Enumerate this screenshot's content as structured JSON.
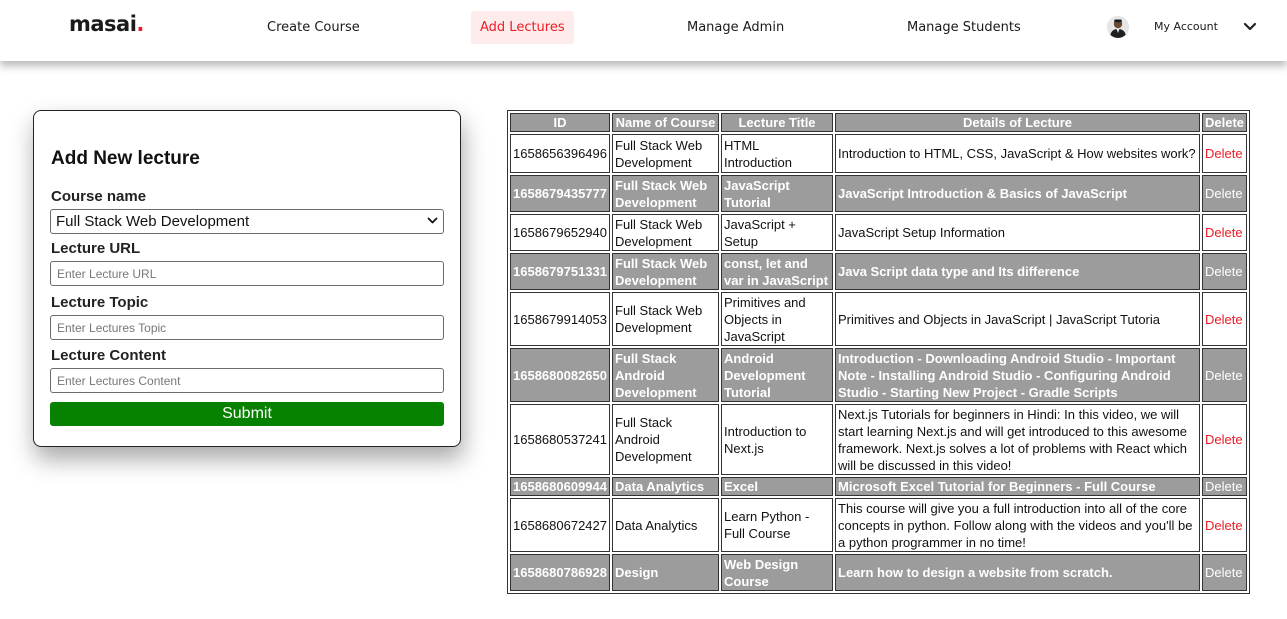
{
  "navbar": {
    "logo": "masai",
    "logo_dot": ".",
    "links": [
      "Create Course",
      "Add Lectures",
      "Manage Admin",
      "Manage Students"
    ],
    "account_label": "My Account"
  },
  "form": {
    "title": "Add New lecture",
    "course_label": "Course name",
    "course_value": "Full Stack Web Development",
    "url_label": "Lecture URL",
    "url_placeholder": "Enter Lecture URL",
    "topic_label": "Lecture Topic",
    "topic_placeholder": "Enter Lectures Topic",
    "content_label": "Lecture Content",
    "content_placeholder": "Enter Lectures Content",
    "submit_label": "Submit"
  },
  "table": {
    "headers": [
      "ID",
      "Name of Course",
      "Lecture Title",
      "Details of Lecture",
      "Delete"
    ],
    "rows": [
      {
        "id": "1658656396496",
        "course": "Full Stack Web Development",
        "title": "HTML Introduction",
        "details": "Introduction to HTML, CSS, JavaScript & How websites work?",
        "action": "Delete"
      },
      {
        "id": "1658679435777",
        "course": "Full Stack Web Development",
        "title": "JavaScript Tutorial",
        "details": "JavaScript Introduction & Basics of JavaScript",
        "action": "Delete"
      },
      {
        "id": "1658679652940",
        "course": "Full Stack Web Development",
        "title": "JavaScript + Setup",
        "details": "JavaScript Setup Information",
        "action": "Delete"
      },
      {
        "id": "1658679751331",
        "course": "Full Stack Web Development",
        "title": "const, let and var in JavaScript",
        "details": "Java Script data type and Its difference",
        "action": "Delete"
      },
      {
        "id": "1658679914053",
        "course": "Full Stack Web Development",
        "title": "Primitives and Objects in JavaScript",
        "details": "Primitives and Objects in JavaScript | JavaScript Tutoria",
        "action": "Delete"
      },
      {
        "id": "1658680082650",
        "course": "Full Stack Android Development",
        "title": "Android Development Tutorial",
        "details": "Introduction - Downloading Android Studio - Important Note - Installing Android Studio - Configuring Android Studio - Starting New Project - Gradle Scripts",
        "action": "Delete"
      },
      {
        "id": "1658680537241",
        "course": "Full Stack Android Development",
        "title": "Introduction to Next.js",
        "details": "Next.js Tutorials for beginners in Hindi: In this video, we will start learning Next.js and will get introduced to this awesome framework. Next.js solves a lot of problems with React which will be discussed in this video!",
        "action": "Delete"
      },
      {
        "id": "1658680609944",
        "course": "Data Analytics",
        "title": "Excel",
        "details": "Microsoft Excel Tutorial for Beginners - Full Course",
        "action": "Delete"
      },
      {
        "id": "1658680672427",
        "course": "Data Analytics",
        "title": "Learn Python - Full Course",
        "details": "This course will give you a full introduction into all of the core concepts in python. Follow along with the videos and you'll be a python programmer in no time!",
        "action": "Delete"
      },
      {
        "id": "1658680786928",
        "course": "Design",
        "title": "Web Design Course",
        "details": "Learn how to design a website from scratch.",
        "action": "Delete"
      }
    ]
  },
  "colors": {
    "brand_red": "#ed1c24",
    "submit_green": "#068100",
    "row_gray": "#9c9c9c"
  },
  "icons": {
    "avatar": "user-avatar",
    "account_chevron": "chevron-down-icon",
    "select_caret": "chevron-down-icon"
  }
}
